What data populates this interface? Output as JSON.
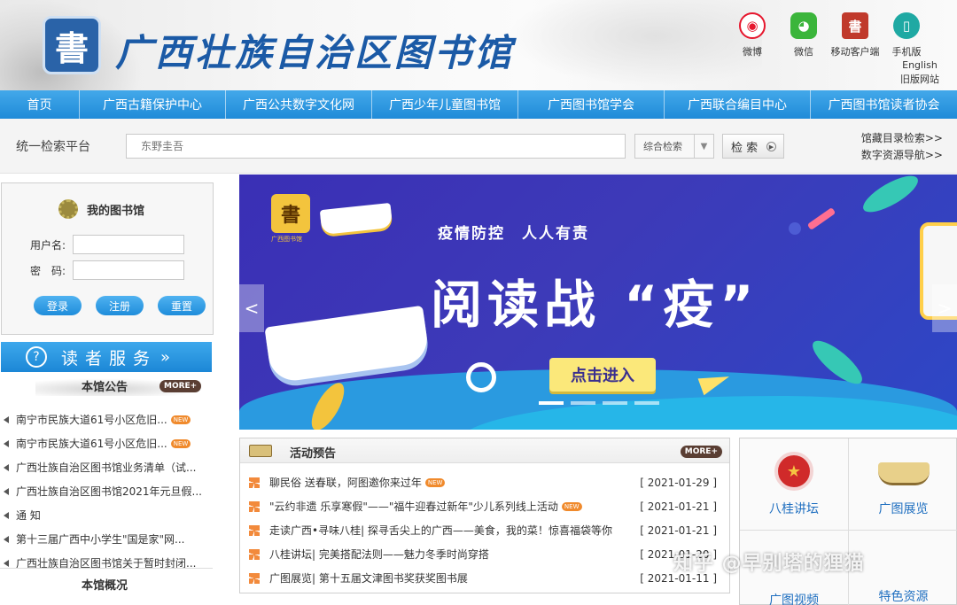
{
  "header": {
    "logo_text": "書",
    "site_title": "广西壮族自治区图书馆",
    "icons": [
      {
        "label": "微博",
        "icon": "weibo-icon",
        "glyph": "◉"
      },
      {
        "label": "微信",
        "icon": "wechat-icon",
        "glyph": "◕"
      },
      {
        "label": "移动客户端",
        "icon": "mobile-client-icon",
        "glyph": "書"
      },
      {
        "label": "手机版",
        "icon": "mobile-version-icon",
        "glyph": "▯"
      }
    ],
    "english_link": "English",
    "old_site_link": "旧版网站"
  },
  "nav": {
    "items": [
      "首页",
      "广西古籍保护中心",
      "广西公共数字文化网",
      "广西少年儿童图书馆",
      "广西图书馆学会",
      "广西联合编目中心",
      "广西图书馆读者协会"
    ]
  },
  "search": {
    "label": "统一检索平台",
    "placeholder": "东野圭吾",
    "select_value": "综合检索",
    "button_label": "检 索",
    "link_catalog": "馆藏目录检索>>",
    "link_digital": "数字资源导航>>"
  },
  "mylib": {
    "title": "我的图书馆",
    "username_label": "用户名:",
    "password_label": "密　码:",
    "login": "登录",
    "register": "注册",
    "reset": "重置"
  },
  "reader_service": {
    "label": "读者服务",
    "icon": "question-icon"
  },
  "notices": {
    "title": "本馆公告",
    "more": "MORE+",
    "new_tag": "NEW",
    "items": [
      {
        "text": "南宁市民族大道61号小区危旧...",
        "new": true
      },
      {
        "text": "南宁市民族大道61号小区危旧...",
        "new": true
      },
      {
        "text": "广西壮族自治区图书馆业务清单（试...",
        "new": false
      },
      {
        "text": "广西壮族自治区图书馆2021年元旦假...",
        "new": false
      },
      {
        "text": "通 知",
        "new": false
      },
      {
        "text": "第十三届广西中小学生\"国是家\"网...",
        "new": false
      },
      {
        "text": "广西壮族自治区图书馆关于暂时封闭...",
        "new": false
      }
    ]
  },
  "overview": {
    "title": "本馆概况"
  },
  "banner": {
    "logo_text": "書",
    "logo_sub": "广西图书馆",
    "subtitle": "疫情防控　人人有责",
    "headline": "阅读战 “疫”",
    "button_label": "点击进入",
    "prev": "<",
    "next": ">",
    "active_slide": 0,
    "slide_count": 4
  },
  "activities": {
    "title": "活动预告",
    "more": "MORE+",
    "new_tag": "NEW",
    "items": [
      {
        "text": "聊民俗 送春联，阿图邀你来过年",
        "date": "[ 2021-01-29 ]",
        "new": true
      },
      {
        "text": "\"云约非遗 乐享寒假\"——\"福牛迎春过新年\"少儿系列线上活动",
        "date": "[ 2021-01-21 ]",
        "new": true
      },
      {
        "text": "走读广西•寻味八桂| 探寻舌尖上的广西——美食，我的菜！惊喜福袋等你",
        "date": "[ 2021-01-21 ]",
        "new": false
      },
      {
        "text": "八桂讲坛| 完美搭配法则——魅力冬季时尚穿搭",
        "date": "[ 2021-01-20 ]",
        "new": false
      },
      {
        "text": "广图展览| 第十五届文津图书奖获奖图书展",
        "date": "[ 2021-01-11 ]",
        "new": false
      }
    ]
  },
  "services": {
    "items": [
      "八桂讲坛",
      "广图展览",
      "广图视频",
      "特色资源"
    ]
  },
  "watermark": "知乎 @早别塔的狸猫",
  "colors": {
    "nav_blue": "#1f8bd8",
    "brand_blue": "#1b5aa6",
    "banner_purple": "#3a2fb5",
    "accent_orange": "#f28a3c"
  }
}
